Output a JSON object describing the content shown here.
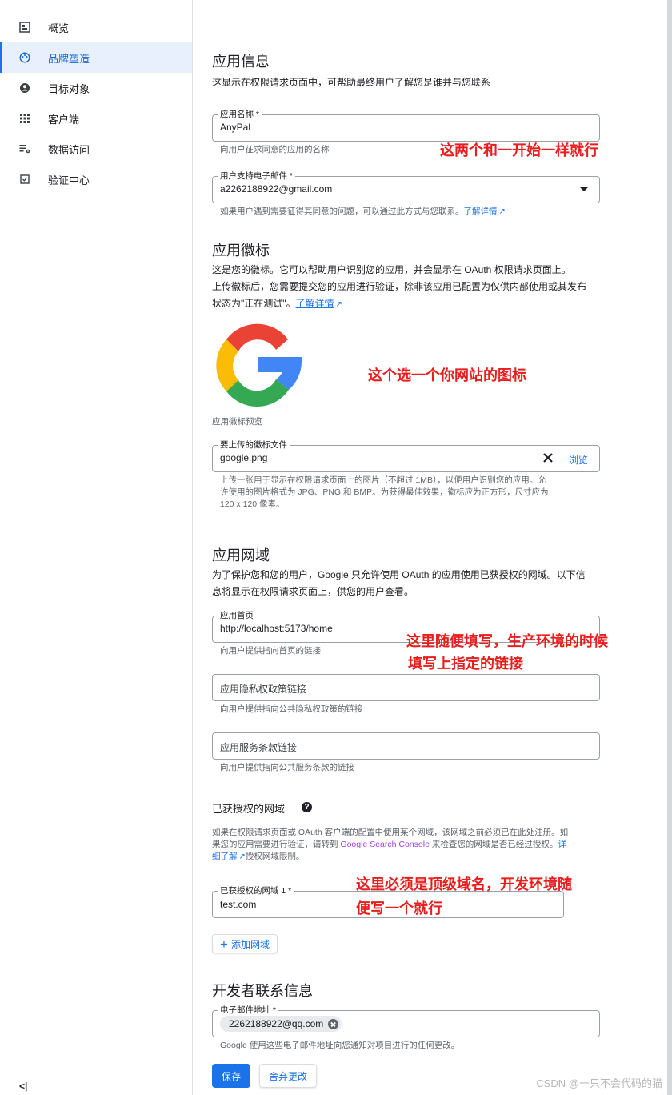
{
  "sidebar": {
    "items": [
      {
        "label": "概览",
        "icon": "dashboard-icon"
      },
      {
        "label": "品牌塑造",
        "icon": "palette-icon",
        "active": true
      },
      {
        "label": "目标对象",
        "icon": "person-icon"
      },
      {
        "label": "客户端",
        "icon": "grid-icon"
      },
      {
        "label": "数据访问",
        "icon": "list-settings-icon"
      },
      {
        "label": "验证中心",
        "icon": "checkbox-icon"
      }
    ],
    "collapse_label": "<|"
  },
  "app_info": {
    "title": "应用信息",
    "desc": "这显示在权限请求页面中，可帮助最终用户了解您是谁并与您联系",
    "name_label": "应用名称 *",
    "name_value": "AnyPal",
    "name_hint": "向用户征求同意的应用的名称",
    "email_label": "用户支持电子邮件 *",
    "email_value": "a2262188922@gmail.com",
    "email_hint": "如果用户遇到需要征得其同意的问题，可以通过此方式与您联系。",
    "email_hint_link": "了解详情"
  },
  "logo": {
    "title": "应用徽标",
    "desc_1": "这是您的徽标。它可以帮助用户识别您的应用，并会显示在 OAuth 权限请求页面上。",
    "desc_2": "上传徽标后，您需要提交您的应用进行验证，除非该应用已配置为仅供内部使用或其发布",
    "desc_3": "状态为\"正在测试\"。",
    "desc_link": "了解详情",
    "preview_caption": "应用徽标预览",
    "file_label": "要上传的徽标文件",
    "file_value": "google.png",
    "browse_label": "浏览",
    "file_hint_1": "上传一张用于显示在权限请求页面上的图片（不超过 1MB），以便用户识别您的应用。允",
    "file_hint_2": "许使用的图片格式为 JPG、PNG 和 BMP。为获得最佳效果，徽标应为正方形，尺寸应为",
    "file_hint_3": "120 x 120 像素。"
  },
  "domain": {
    "title": "应用网域",
    "desc_1": "为了保护您和您的用户，Google 只允许使用 OAuth 的应用使用已获授权的网域。以下信",
    "desc_2": "息将显示在权限请求页面上，供您的用户查看。",
    "home_label": "应用首页",
    "home_value": "http://localhost:5173/home",
    "home_hint": "向用户提供指向首页的链接",
    "privacy_placeholder": "应用隐私权政策链接",
    "privacy_hint": "向用户提供指向公共隐私权政策的链接",
    "tos_placeholder": "应用服务条款链接",
    "tos_hint": "向用户提供指向公共服务条款的链接"
  },
  "authorized": {
    "title": "已获授权的网域",
    "help": "?",
    "desc_1a": "如果在权限请求页面或 OAuth 客户端的配置中使用某个网域，该网域之前必须已在此处注册。如",
    "desc_2a": "果您的应用需要进行验证，请转到 ",
    "desc_2_link": "Google Search Console",
    "desc_2b": " 来检查您的网域是否已经过授权。",
    "desc_2_link2": "详",
    "desc_3_link": "细了解",
    "desc_3b": "授权网域限制。",
    "domain1_label": "已获授权的网域 1 *",
    "domain1_value": "test.com",
    "add_label": "添加网域"
  },
  "developer": {
    "title": "开发者联系信息",
    "email_label": "电子邮件地址 *",
    "email_chip": "2262188922@qq.com",
    "email_hint": "Google 使用这些电子邮件地址向您通知对项目进行的任何更改。"
  },
  "actions": {
    "save": "保存",
    "discard": "舍弃更改"
  },
  "annotations": {
    "a1": "这两个和一开始一样就行",
    "a2": "这个选一个你网站的图标",
    "a3_1": "这里随便填写，生产环境的时候",
    "a3_2": "填写上指定的链接",
    "a4_1": "这里必须是顶级域名，开发环境随",
    "a4_2": "便写一个就行"
  },
  "watermark": "CSDN @一只不会代码的猫",
  "colors": {
    "accent": "#1a73e8",
    "annotation": "#ea1d1d",
    "active_bg": "#e8f0fe"
  }
}
